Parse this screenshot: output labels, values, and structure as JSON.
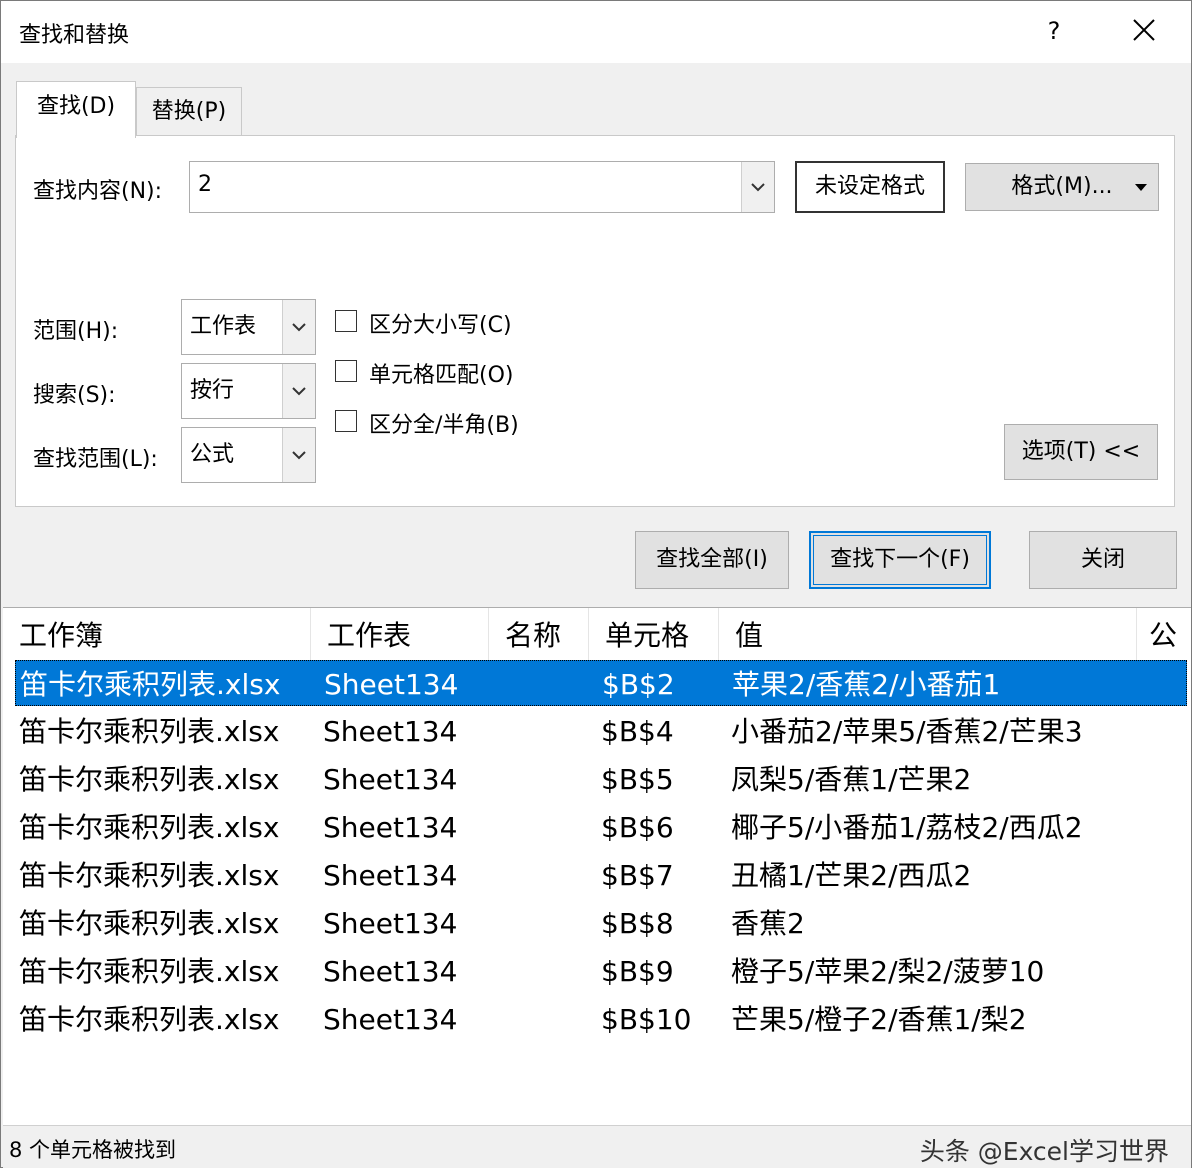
{
  "title": "查找和替换",
  "help_label": "?",
  "tabs": [
    {
      "label": "查找(D)",
      "active": true
    },
    {
      "label": "替换(P)",
      "active": false
    }
  ],
  "find": {
    "label": "查找内容(N):",
    "value": "2",
    "format_state": "未设定格式",
    "format_button": "格式(M)..."
  },
  "options": {
    "scope": {
      "label": "范围(H):",
      "value": "工作表"
    },
    "search": {
      "label": "搜索(S):",
      "value": "按行"
    },
    "look_in": {
      "label": "查找范围(L):",
      "value": "公式"
    },
    "checkboxes": [
      {
        "label": "区分大小写(C)",
        "checked": false
      },
      {
        "label": "单元格匹配(O)",
        "checked": false
      },
      {
        "label": "区分全/半角(B)",
        "checked": false
      }
    ],
    "options_button": "选项(T) <<"
  },
  "actions": {
    "find_all": "查找全部(I)",
    "find_next": "查找下一个(F)",
    "close": "关闭"
  },
  "results": {
    "columns": [
      "工作簿",
      "工作表",
      "名称",
      "单元格",
      "值",
      "公"
    ],
    "rows": [
      {
        "book": "笛卡尔乘积列表.xlsx",
        "sheet": "Sheet134",
        "name": "",
        "cell": "$B$2",
        "value": "苹果2/香蕉2/小番茄1"
      },
      {
        "book": "笛卡尔乘积列表.xlsx",
        "sheet": "Sheet134",
        "name": "",
        "cell": "$B$4",
        "value": "小番茄2/苹果5/香蕉2/芒果3"
      },
      {
        "book": "笛卡尔乘积列表.xlsx",
        "sheet": "Sheet134",
        "name": "",
        "cell": "$B$5",
        "value": "凤梨5/香蕉1/芒果2"
      },
      {
        "book": "笛卡尔乘积列表.xlsx",
        "sheet": "Sheet134",
        "name": "",
        "cell": "$B$6",
        "value": "椰子5/小番茄1/荔枝2/西瓜2"
      },
      {
        "book": "笛卡尔乘积列表.xlsx",
        "sheet": "Sheet134",
        "name": "",
        "cell": "$B$7",
        "value": "丑橘1/芒果2/西瓜2"
      },
      {
        "book": "笛卡尔乘积列表.xlsx",
        "sheet": "Sheet134",
        "name": "",
        "cell": "$B$8",
        "value": "香蕉2"
      },
      {
        "book": "笛卡尔乘积列表.xlsx",
        "sheet": "Sheet134",
        "name": "",
        "cell": "$B$9",
        "value": "橙子5/苹果2/梨2/菠萝10"
      },
      {
        "book": "笛卡尔乘积列表.xlsx",
        "sheet": "Sheet134",
        "name": "",
        "cell": "$B$10",
        "value": "芒果5/橙子2/香蕉1/梨2"
      }
    ],
    "selected_index": 0
  },
  "status": "8 个单元格被找到",
  "watermark": "头条 @Excel学习世界",
  "colors": {
    "selection": "#0078d7",
    "default_button_border": "#0078d7"
  }
}
